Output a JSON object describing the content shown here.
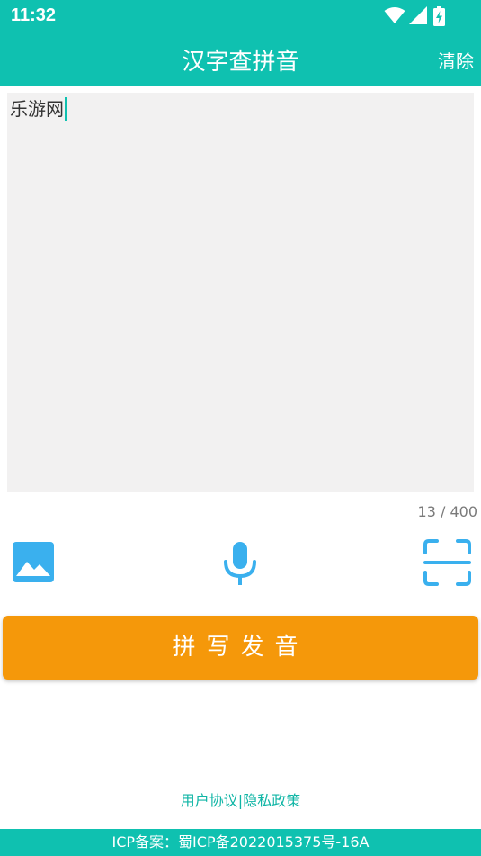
{
  "status_bar": {
    "time": "11:32",
    "icons": [
      "wifi-icon",
      "signal-icon",
      "battery-charging-icon"
    ]
  },
  "app_bar": {
    "title": "汉字查拼音",
    "clear_label": "清除"
  },
  "editor": {
    "value": "乐游网",
    "char_count": "13 / 400"
  },
  "toolbar": {
    "icons": [
      "image-icon",
      "microphone-icon",
      "scan-icon"
    ]
  },
  "primary_button": {
    "label": "拼写发音"
  },
  "links": {
    "user_agreement": "用户协议",
    "separator": "|",
    "privacy_policy": "隐私政策"
  },
  "footer": {
    "icp_text": "ICP备案：蜀ICP备2022015375号-16A"
  },
  "colors": {
    "primary": "#0fc1b0",
    "accent": "#f5980a",
    "icon_blue": "#3ab0ee",
    "input_bg": "#f2f1f1"
  }
}
